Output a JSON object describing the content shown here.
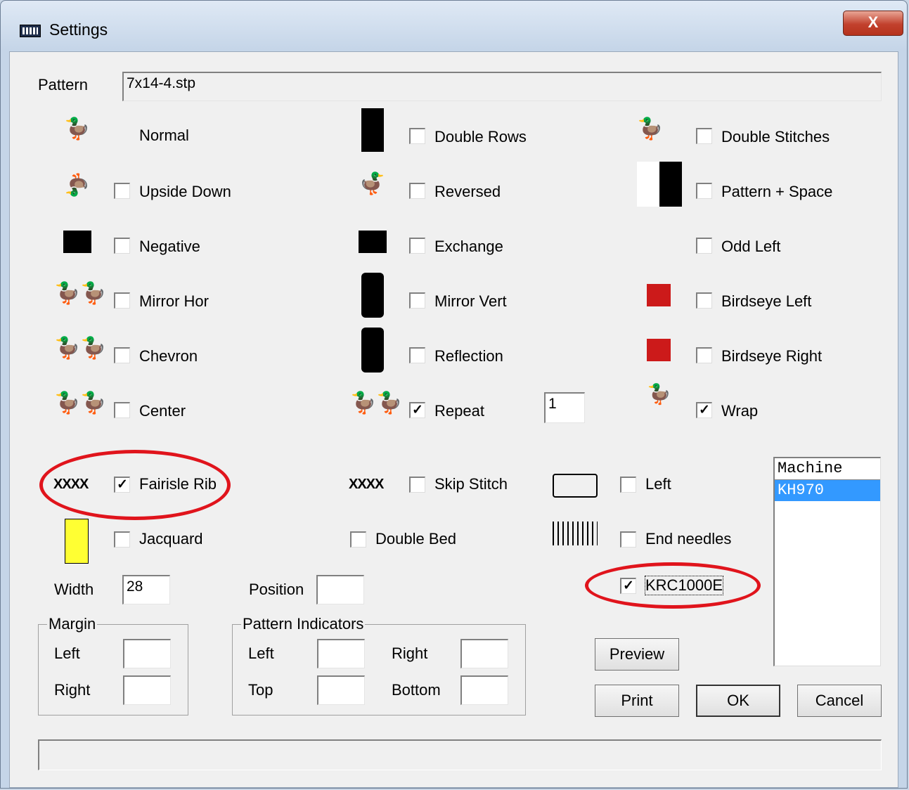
{
  "window": {
    "title": "Settings",
    "close_glyph": "X"
  },
  "pattern": {
    "label": "Pattern",
    "value": "7x14-4.stp"
  },
  "options": {
    "normal": {
      "label": "Normal"
    },
    "double_rows": {
      "label": "Double Rows",
      "checked": false
    },
    "double_stitches": {
      "label": "Double Stitches",
      "checked": false
    },
    "upside_down": {
      "label": "Upside Down",
      "checked": false
    },
    "reversed": {
      "label": "Reversed",
      "checked": false
    },
    "pattern_space": {
      "label": "Pattern + Space",
      "checked": false
    },
    "negative": {
      "label": "Negative",
      "checked": false
    },
    "exchange": {
      "label": "Exchange",
      "checked": false
    },
    "odd_left": {
      "label": "Odd Left",
      "checked": false
    },
    "mirror_hor": {
      "label": "Mirror Hor",
      "checked": false
    },
    "mirror_vert": {
      "label": "Mirror Vert",
      "checked": false
    },
    "birdseye_left": {
      "label": "Birdseye Left",
      "checked": false
    },
    "chevron": {
      "label": "Chevron",
      "checked": false
    },
    "reflection": {
      "label": "Reflection",
      "checked": false
    },
    "birdseye_right": {
      "label": "Birdseye Right",
      "checked": false
    },
    "center": {
      "label": "Center",
      "checked": false
    },
    "repeat": {
      "label": "Repeat",
      "checked": true,
      "count": "1"
    },
    "wrap": {
      "label": "Wrap",
      "checked": true
    },
    "fairisle_rib": {
      "label": "Fairisle Rib",
      "checked": true,
      "icon_text": "XXXX"
    },
    "skip_stitch": {
      "label": "Skip Stitch",
      "checked": false,
      "icon_text": "XXXX"
    },
    "left": {
      "label": "Left",
      "checked": false
    },
    "jacquard": {
      "label": "Jacquard",
      "checked": false
    },
    "double_bed": {
      "label": "Double Bed",
      "checked": false
    },
    "end_needles": {
      "label": "End needles",
      "checked": false
    },
    "krc1000e": {
      "label": "KRC1000E",
      "checked": true
    }
  },
  "width": {
    "label": "Width",
    "value": "28"
  },
  "position": {
    "label": "Position",
    "value": ""
  },
  "margin": {
    "title": "Margin",
    "left_label": "Left",
    "right_label": "Right",
    "left_value": "",
    "right_value": ""
  },
  "indicators": {
    "title": "Pattern Indicators",
    "left_label": "Left",
    "right_label": "Right",
    "top_label": "Top",
    "bottom_label": "Bottom"
  },
  "machine": {
    "header": "Machine",
    "items": [
      "KH970"
    ],
    "selected": "KH970"
  },
  "buttons": {
    "preview": "Preview",
    "print": "Print",
    "ok": "OK",
    "cancel": "Cancel"
  },
  "check_mark": "✓",
  "colors": {
    "highlight": "#e0141c",
    "selection": "#3399ff"
  }
}
